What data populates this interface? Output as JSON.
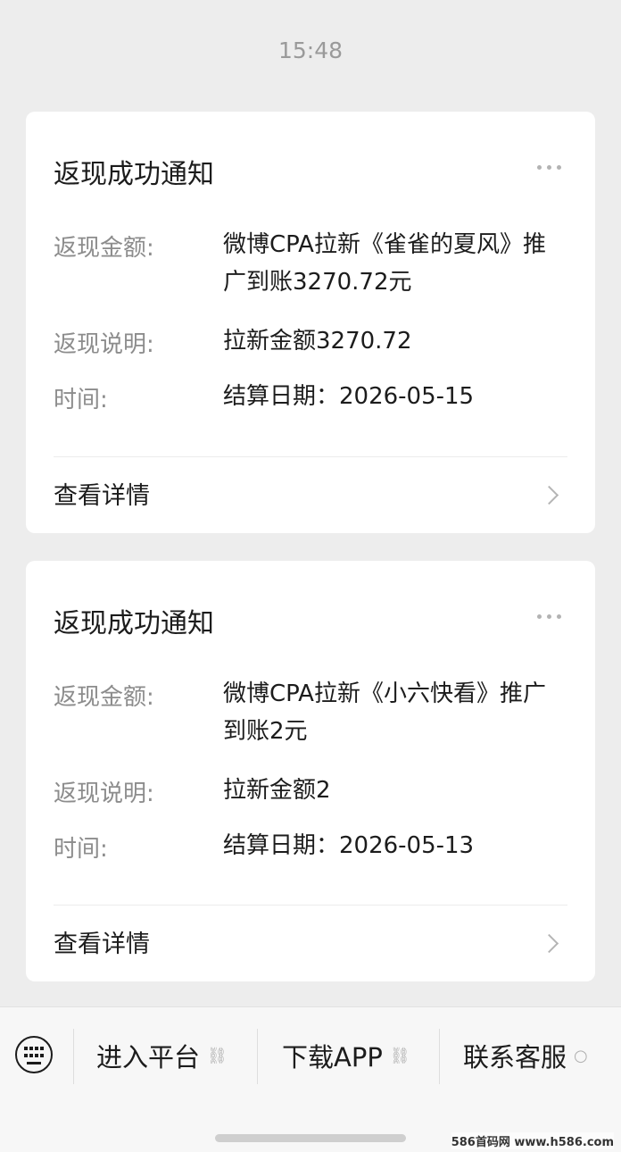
{
  "status": {
    "time": "15:48"
  },
  "messages": [
    {
      "title": "返现成功通知",
      "amount_label": "返现金额:",
      "amount_value": "微博CPA拉新《雀雀的夏风》推广到账3270.72元",
      "desc_label": "返现说明:",
      "desc_value": "拉新金额3270.72",
      "time_label": "时间:",
      "time_value": "结算日期：2026-05-15",
      "detail_label": "查看详情"
    },
    {
      "title": "返现成功通知",
      "amount_label": "返现金额:",
      "amount_value": "微博CPA拉新《小六快看》推广到账2元",
      "desc_label": "返现说明:",
      "desc_value": "拉新金额2",
      "time_label": "时间:",
      "time_value": "结算日期：2026-05-13",
      "detail_label": "查看详情"
    }
  ],
  "menu": {
    "keyboard_icon": "keyboard-icon",
    "items": [
      {
        "label": "进入平台",
        "icon": "link-icon"
      },
      {
        "label": "下载APP",
        "icon": "link-icon"
      },
      {
        "label": "联系客服",
        "icon": "chat-bubble-icon"
      }
    ]
  },
  "watermark": "586首码网 www.h586.com"
}
